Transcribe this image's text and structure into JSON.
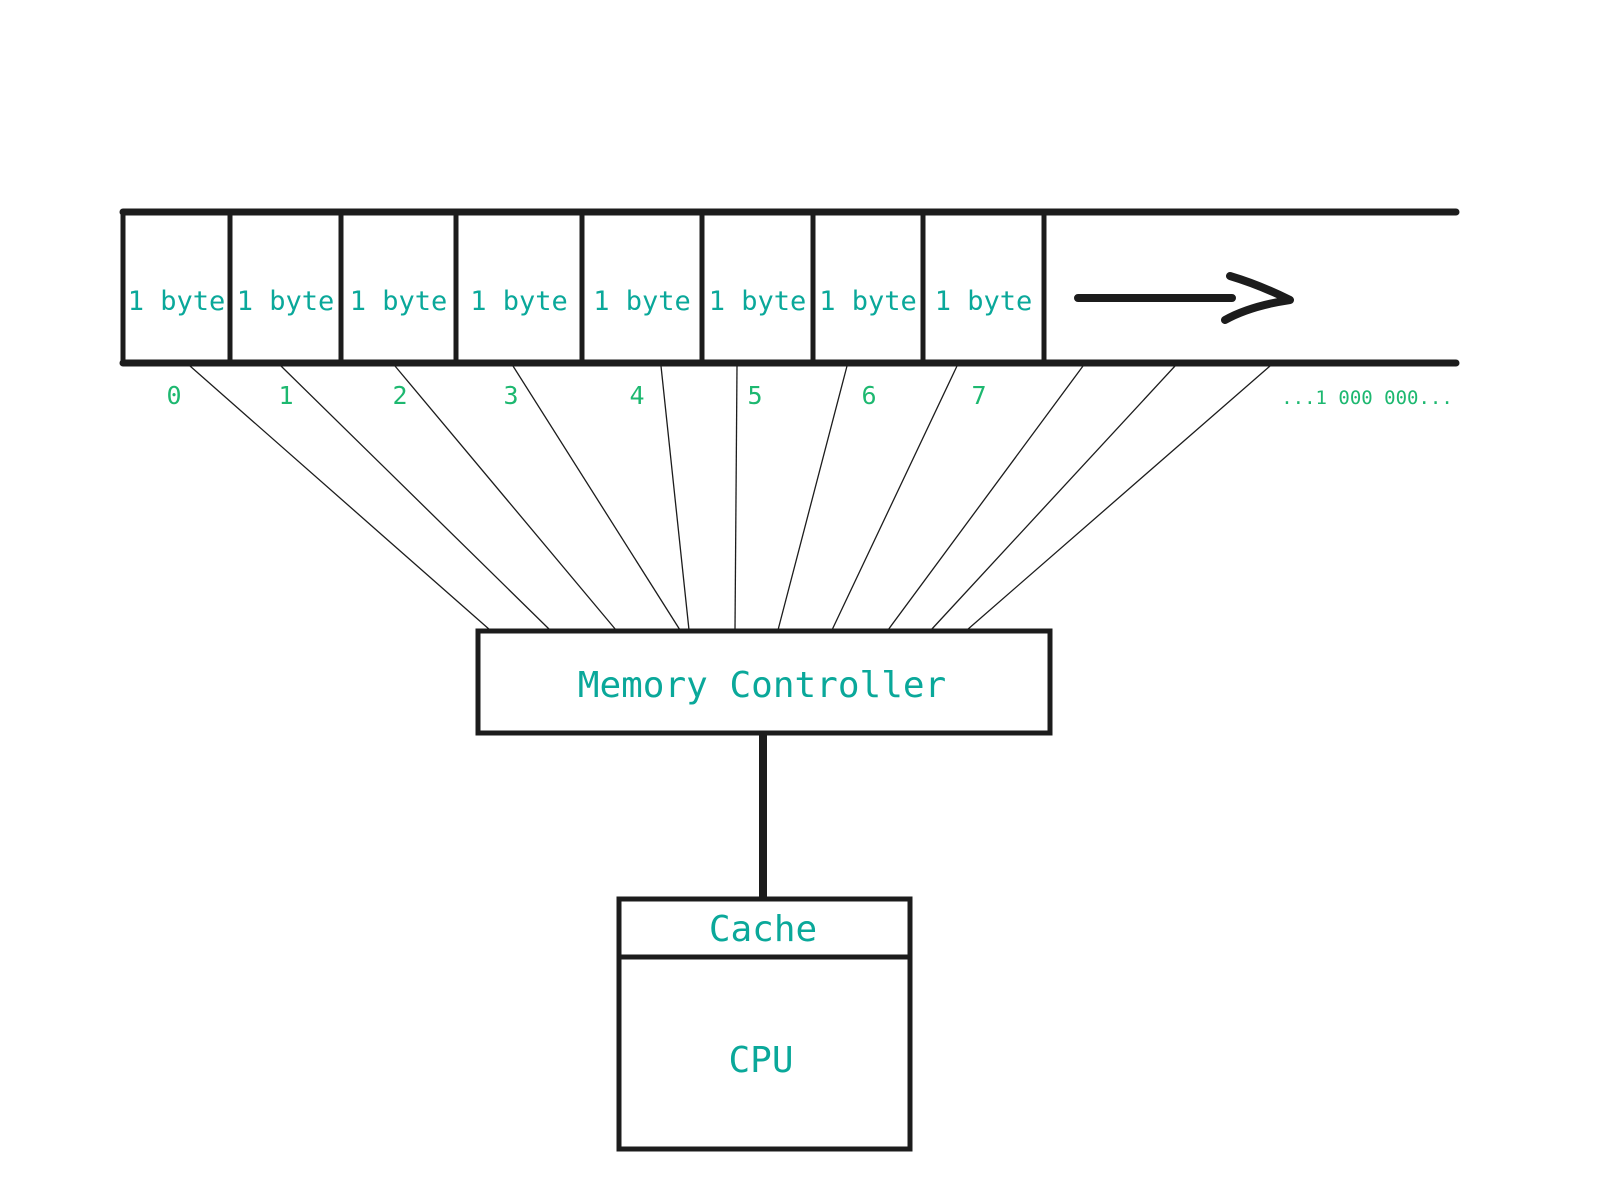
{
  "memory": {
    "cells": [
      "1 byte",
      "1 byte",
      "1 byte",
      "1 byte",
      "1 byte",
      "1 byte",
      "1 byte",
      "1 byte"
    ],
    "indices": [
      "0",
      "1",
      "2",
      "3",
      "4",
      "5",
      "6",
      "7"
    ],
    "more_label": "...1 000 000..."
  },
  "controller": {
    "label": "Memory Controller"
  },
  "cpu": {
    "cache_label": "Cache",
    "label": "CPU"
  },
  "colors": {
    "text": "#0aa89a",
    "index": "#1db870",
    "stroke": "#1c1c1c"
  }
}
